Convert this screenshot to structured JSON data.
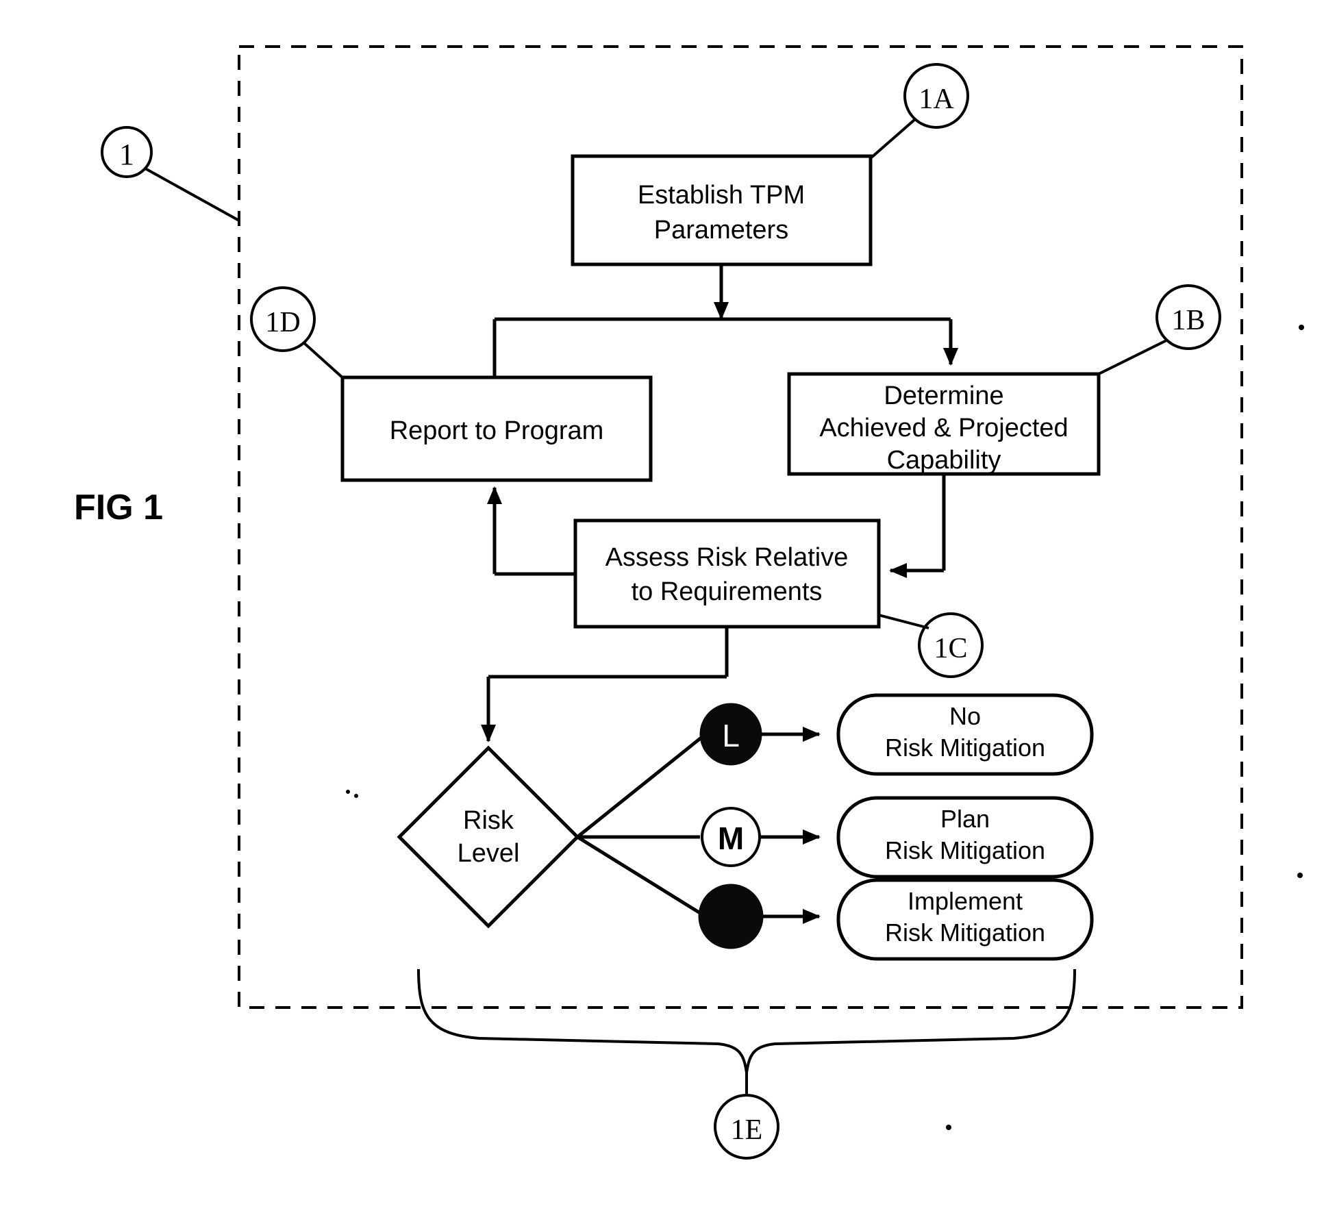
{
  "figure": {
    "label": "FIG 1",
    "root_ref": "1",
    "dashed_boundary": true
  },
  "reference_numerals": [
    {
      "id": "ref-1",
      "text": "1"
    },
    {
      "id": "ref-1a",
      "text": "1A"
    },
    {
      "id": "ref-1b",
      "text": "1B"
    },
    {
      "id": "ref-1c",
      "text": "1C"
    },
    {
      "id": "ref-1d",
      "text": "1D"
    },
    {
      "id": "ref-1e",
      "text": "1E"
    }
  ],
  "process_boxes": [
    {
      "id": "establish-tpm-parameters",
      "ref": "1A",
      "shape": "rectangle",
      "lines": [
        "Establish TPM",
        "Parameters"
      ]
    },
    {
      "id": "report-to-program",
      "ref": "1D",
      "shape": "rectangle",
      "lines": [
        "Report to Program"
      ]
    },
    {
      "id": "determine-achieved-projected-capability",
      "ref": "1B",
      "shape": "rectangle",
      "lines": [
        "Determine",
        "Achieved & Projected",
        "Capability"
      ]
    },
    {
      "id": "assess-risk-relative-to-requirements",
      "ref": "1C",
      "shape": "rectangle",
      "lines": [
        "Assess Risk Relative",
        "to Requirements"
      ]
    }
  ],
  "decision": {
    "id": "risk-level",
    "shape": "diamond",
    "lines": [
      "Risk",
      "Level"
    ]
  },
  "risk_markers": [
    {
      "id": "marker-low",
      "letter": "L",
      "style": "filled-dark",
      "glyph_color": "#ffffff"
    },
    {
      "id": "marker-medium",
      "letter": "M",
      "style": "open-white",
      "glyph_color": "#000000"
    },
    {
      "id": "marker-high",
      "letter": "",
      "style": "solid-black",
      "glyph_color": "#000000"
    }
  ],
  "outcome_boxes": [
    {
      "id": "no-risk-mitigation",
      "shape": "rounded-rectangle",
      "lines": [
        "No",
        "Risk Mitigation"
      ]
    },
    {
      "id": "plan-risk-mitigation",
      "shape": "rounded-rectangle",
      "lines": [
        "Plan",
        "Risk Mitigation"
      ]
    },
    {
      "id": "implement-risk-mitigation",
      "shape": "rounded-rectangle",
      "lines": [
        "Implement",
        "Risk Mitigation"
      ]
    }
  ],
  "colors": {
    "ink": "#000000",
    "paper": "#ffffff",
    "marker_dark": "#0a0a0a"
  }
}
